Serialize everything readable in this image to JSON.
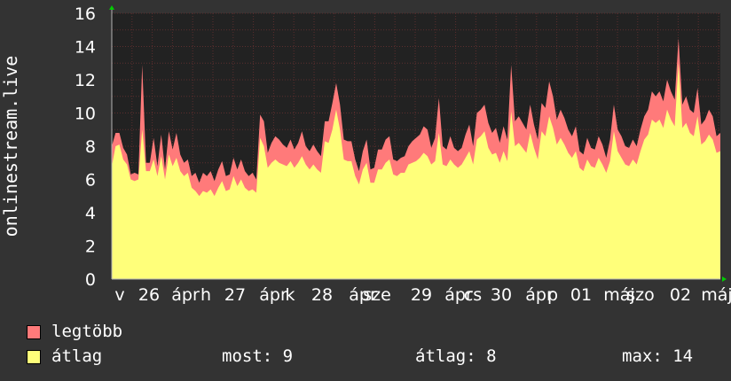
{
  "chart_data": {
    "type": "area",
    "ylabel": "onlinestream.live",
    "ylim": [
      0,
      16
    ],
    "yticks": [
      0,
      2,
      4,
      6,
      8,
      10,
      12,
      14,
      16
    ],
    "x_tick_labels": [
      "v",
      "26",
      "ápr",
      "h",
      "27",
      "ápr",
      "k",
      "28",
      "ápr",
      "sze",
      "29",
      "ápr",
      "cs",
      "30",
      "ápr",
      "p",
      "01",
      "máj",
      "szo",
      "02",
      "máj"
    ],
    "grid": true,
    "series": [
      {
        "name": "legtöbb",
        "color": "#ff7a7a",
        "values": [
          8.0,
          8.8,
          8.8,
          7.9,
          7.5,
          6.3,
          6.4,
          6.3,
          12.9,
          7.0,
          7.0,
          8.5,
          6.8,
          8.7,
          6.6,
          8.9,
          7.8,
          8.8,
          7.5,
          7.0,
          7.2,
          6.2,
          6.4,
          5.8,
          6.4,
          6.2,
          6.5,
          5.9,
          6.6,
          7.1,
          6.2,
          6.3,
          7.3,
          6.6,
          7.2,
          6.5,
          6.2,
          6.4,
          6.0,
          9.9,
          9.5,
          7.6,
          8.2,
          8.6,
          8.4,
          8.1,
          7.9,
          8.4,
          7.8,
          8.2,
          8.9,
          8.0,
          7.7,
          8.1,
          7.7,
          7.4,
          9.5,
          9.5,
          10.6,
          11.8,
          10.5,
          8.4,
          8.3,
          8.3,
          7.2,
          6.5,
          7.7,
          8.4,
          6.6,
          6.7,
          7.8,
          7.8,
          8.4,
          8.6,
          7.2,
          7.1,
          7.3,
          7.4,
          8.0,
          8.3,
          8.5,
          8.7,
          9.2,
          9.0,
          7.9,
          8.5,
          10.9,
          8.0,
          7.8,
          8.6,
          7.9,
          7.7,
          7.9,
          8.7,
          9.3,
          8.0,
          10.0,
          10.2,
          10.5,
          9.4,
          8.8,
          9.1,
          8.2,
          9.2,
          8.4,
          12.9,
          9.5,
          9.8,
          9.4,
          9.0,
          10.5,
          9.3,
          8.4,
          10.6,
          10.3,
          11.9,
          11.0,
          9.6,
          10.2,
          9.7,
          9.0,
          8.6,
          9.2,
          7.7,
          7.5,
          8.5,
          7.9,
          7.8,
          8.6,
          8.1,
          7.3,
          8.4,
          10.5,
          9.0,
          8.6,
          8.0,
          7.9,
          8.4,
          8.0,
          9.0,
          9.8,
          10.2,
          11.3,
          11.0,
          11.3,
          10.7,
          12.0,
          11.3,
          10.8,
          14.5,
          10.5,
          11.0,
          10.2,
          10.0,
          11.5,
          9.3,
          9.6,
          10.2,
          9.8,
          8.6,
          8.8
        ]
      },
      {
        "name": "átlag",
        "color": "#ffff7a",
        "values": [
          6.8,
          8.0,
          8.1,
          7.2,
          6.9,
          6.0,
          5.9,
          6.0,
          9.0,
          6.5,
          6.5,
          7.2,
          6.2,
          7.4,
          6.0,
          7.5,
          6.8,
          7.3,
          6.5,
          6.2,
          6.4,
          5.5,
          5.3,
          5.0,
          5.3,
          5.2,
          5.4,
          5.0,
          5.5,
          5.9,
          5.3,
          5.4,
          6.2,
          5.6,
          6.0,
          5.5,
          5.3,
          5.4,
          5.2,
          8.5,
          8.0,
          6.7,
          7.0,
          7.2,
          7.0,
          6.9,
          6.8,
          7.1,
          6.7,
          7.0,
          7.4,
          6.9,
          6.6,
          6.9,
          6.6,
          6.4,
          8.3,
          8.2,
          9.0,
          10.2,
          9.0,
          7.2,
          7.1,
          7.1,
          6.2,
          5.7,
          6.6,
          7.0,
          5.8,
          5.8,
          6.6,
          6.6,
          7.0,
          7.2,
          6.3,
          6.2,
          6.4,
          6.4,
          6.9,
          7.0,
          7.1,
          7.3,
          7.6,
          7.4,
          6.9,
          7.1,
          8.8,
          6.9,
          6.8,
          7.2,
          6.9,
          6.7,
          6.9,
          7.3,
          7.7,
          6.9,
          8.4,
          8.6,
          8.9,
          7.9,
          7.5,
          7.6,
          7.0,
          7.7,
          7.1,
          10.1,
          8.0,
          8.2,
          7.9,
          7.6,
          8.8,
          7.9,
          7.2,
          8.9,
          8.6,
          9.8,
          9.1,
          8.1,
          8.5,
          8.1,
          7.6,
          7.3,
          7.7,
          6.7,
          6.5,
          7.2,
          6.8,
          6.7,
          7.3,
          6.9,
          6.4,
          7.1,
          8.9,
          7.7,
          7.3,
          6.9,
          6.8,
          7.2,
          6.9,
          7.7,
          8.4,
          8.7,
          9.6,
          9.4,
          9.6,
          9.1,
          10.2,
          9.6,
          9.2,
          13.0,
          9.1,
          9.4,
          8.8,
          8.6,
          9.8,
          8.1,
          8.3,
          8.7,
          8.4,
          7.6,
          7.7
        ]
      }
    ]
  },
  "legend": {
    "items": [
      {
        "label": "legtöbb",
        "color": "#ff7a7a"
      },
      {
        "label": "átlag",
        "color": "#ffff7a"
      }
    ]
  },
  "stats": {
    "now": "most: 9",
    "avg": "átlag: 8",
    "max": "max: 14"
  },
  "colors": {
    "background": "#333333",
    "plot_background": "#222222",
    "grid": "#5c2e2e",
    "axis": "#b3b3b3",
    "arrow": "#00cc00"
  }
}
